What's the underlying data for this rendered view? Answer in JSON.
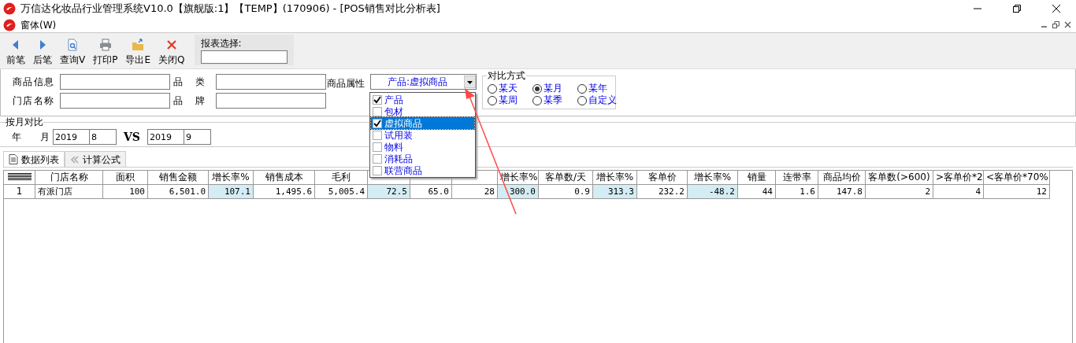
{
  "window": {
    "title": "万信达化妆品行业管理系统V10.0【旗舰版:1】【TEMP】(170906) - [POS销售对比分析表]"
  },
  "menu": [
    {
      "label": "窗体(W)"
    }
  ],
  "toolbar": {
    "buttons": [
      {
        "label": "前笔"
      },
      {
        "label": "后笔"
      },
      {
        "label": "查询V"
      },
      {
        "label": "打印P"
      },
      {
        "label": "导出E"
      },
      {
        "label": "关闭Q"
      }
    ],
    "report_label": "报表选择:"
  },
  "filters": [
    {
      "label": "商品信息"
    },
    {
      "label": "品 类"
    },
    {
      "label": "门店名称"
    },
    {
      "label": "品 牌"
    }
  ],
  "attribute": {
    "label": "商品属性",
    "value": "产品:虚拟商品",
    "expanded": true,
    "options": [
      {
        "label": "产品",
        "checked": true,
        "selected": false
      },
      {
        "label": "包材",
        "checked": false,
        "selected": false
      },
      {
        "label": "虚拟商品",
        "checked": true,
        "selected": true
      },
      {
        "label": "试用装",
        "checked": false,
        "selected": false
      },
      {
        "label": "物料",
        "checked": false,
        "selected": false
      },
      {
        "label": "消耗品",
        "checked": false,
        "selected": false
      },
      {
        "label": "联营商品",
        "checked": false,
        "selected": false
      }
    ]
  },
  "compare_mode": {
    "title": "对比方式",
    "options": [
      {
        "label": "某天",
        "selected": false
      },
      {
        "label": "某月",
        "selected": true
      },
      {
        "label": "某年",
        "selected": false
      },
      {
        "label": "某周",
        "selected": false
      },
      {
        "label": "某季",
        "selected": false
      },
      {
        "label": "自定义",
        "selected": false
      }
    ]
  },
  "monthly": {
    "title": "按月对比",
    "label": "年 月",
    "from_year": "2019",
    "from_month": "8",
    "vs": "VS",
    "to_year": "2019",
    "to_month": "9"
  },
  "tabs": [
    {
      "label": "数据列表",
      "selected": true
    },
    {
      "label": "计算公式",
      "selected": false
    }
  ],
  "table": {
    "columns": [
      {
        "label": "门店名称",
        "highlight": false
      },
      {
        "label": "面积",
        "highlight": false
      },
      {
        "label": "销售金额",
        "highlight": false
      },
      {
        "label": "增长率%",
        "highlight": true
      },
      {
        "label": "销售成本",
        "highlight": false
      },
      {
        "label": "毛利",
        "highlight": false
      },
      {
        "highlight": true
      },
      {
        "highlight": false
      },
      {
        "highlight": false
      },
      {
        "label": "增长率%",
        "highlight": true
      },
      {
        "label": "客单数/天",
        "highlight": false
      },
      {
        "label": "增长率%",
        "highlight": true
      },
      {
        "label": "客单价",
        "highlight": false
      },
      {
        "label": "增长率%",
        "highlight": true
      },
      {
        "label": "销量",
        "highlight": false
      },
      {
        "label": "连带率",
        "highlight": false
      },
      {
        "label": "商品均价",
        "highlight": false
      },
      {
        "label": "客单数(>600)",
        "highlight": false
      },
      {
        "label": ">客单价*2",
        "highlight": false
      },
      {
        "label": "<客单价*70%",
        "highlight": false
      }
    ],
    "rows": [
      {
        "number": "1",
        "cells": [
          "有派门店",
          "100",
          "6,501.0",
          "107.1",
          "1,495.6",
          "5,005.4",
          "72.5",
          "65.0",
          "28",
          "300.0",
          "0.9",
          "313.3",
          "232.2",
          "-48.2",
          "44",
          "1.6",
          "147.8",
          "2",
          "4",
          "12"
        ]
      }
    ]
  }
}
